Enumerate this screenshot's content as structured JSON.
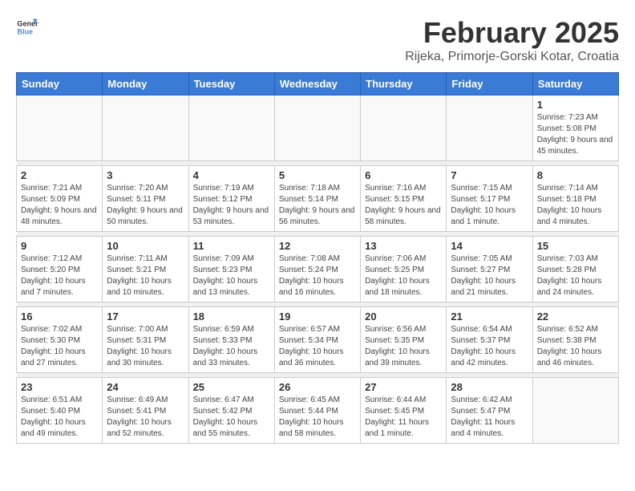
{
  "header": {
    "logo_general": "General",
    "logo_blue": "Blue",
    "title": "February 2025",
    "subtitle": "Rijeka, Primorje-Gorski Kotar, Croatia"
  },
  "weekdays": [
    "Sunday",
    "Monday",
    "Tuesday",
    "Wednesday",
    "Thursday",
    "Friday",
    "Saturday"
  ],
  "weeks": [
    [
      {
        "num": "",
        "info": ""
      },
      {
        "num": "",
        "info": ""
      },
      {
        "num": "",
        "info": ""
      },
      {
        "num": "",
        "info": ""
      },
      {
        "num": "",
        "info": ""
      },
      {
        "num": "",
        "info": ""
      },
      {
        "num": "1",
        "info": "Sunrise: 7:23 AM\nSunset: 5:08 PM\nDaylight: 9 hours and 45 minutes."
      }
    ],
    [
      {
        "num": "2",
        "info": "Sunrise: 7:21 AM\nSunset: 5:09 PM\nDaylight: 9 hours and 48 minutes."
      },
      {
        "num": "3",
        "info": "Sunrise: 7:20 AM\nSunset: 5:11 PM\nDaylight: 9 hours and 50 minutes."
      },
      {
        "num": "4",
        "info": "Sunrise: 7:19 AM\nSunset: 5:12 PM\nDaylight: 9 hours and 53 minutes."
      },
      {
        "num": "5",
        "info": "Sunrise: 7:18 AM\nSunset: 5:14 PM\nDaylight: 9 hours and 56 minutes."
      },
      {
        "num": "6",
        "info": "Sunrise: 7:16 AM\nSunset: 5:15 PM\nDaylight: 9 hours and 58 minutes."
      },
      {
        "num": "7",
        "info": "Sunrise: 7:15 AM\nSunset: 5:17 PM\nDaylight: 10 hours and 1 minute."
      },
      {
        "num": "8",
        "info": "Sunrise: 7:14 AM\nSunset: 5:18 PM\nDaylight: 10 hours and 4 minutes."
      }
    ],
    [
      {
        "num": "9",
        "info": "Sunrise: 7:12 AM\nSunset: 5:20 PM\nDaylight: 10 hours and 7 minutes."
      },
      {
        "num": "10",
        "info": "Sunrise: 7:11 AM\nSunset: 5:21 PM\nDaylight: 10 hours and 10 minutes."
      },
      {
        "num": "11",
        "info": "Sunrise: 7:09 AM\nSunset: 5:23 PM\nDaylight: 10 hours and 13 minutes."
      },
      {
        "num": "12",
        "info": "Sunrise: 7:08 AM\nSunset: 5:24 PM\nDaylight: 10 hours and 16 minutes."
      },
      {
        "num": "13",
        "info": "Sunrise: 7:06 AM\nSunset: 5:25 PM\nDaylight: 10 hours and 18 minutes."
      },
      {
        "num": "14",
        "info": "Sunrise: 7:05 AM\nSunset: 5:27 PM\nDaylight: 10 hours and 21 minutes."
      },
      {
        "num": "15",
        "info": "Sunrise: 7:03 AM\nSunset: 5:28 PM\nDaylight: 10 hours and 24 minutes."
      }
    ],
    [
      {
        "num": "16",
        "info": "Sunrise: 7:02 AM\nSunset: 5:30 PM\nDaylight: 10 hours and 27 minutes."
      },
      {
        "num": "17",
        "info": "Sunrise: 7:00 AM\nSunset: 5:31 PM\nDaylight: 10 hours and 30 minutes."
      },
      {
        "num": "18",
        "info": "Sunrise: 6:59 AM\nSunset: 5:33 PM\nDaylight: 10 hours and 33 minutes."
      },
      {
        "num": "19",
        "info": "Sunrise: 6:57 AM\nSunset: 5:34 PM\nDaylight: 10 hours and 36 minutes."
      },
      {
        "num": "20",
        "info": "Sunrise: 6:56 AM\nSunset: 5:35 PM\nDaylight: 10 hours and 39 minutes."
      },
      {
        "num": "21",
        "info": "Sunrise: 6:54 AM\nSunset: 5:37 PM\nDaylight: 10 hours and 42 minutes."
      },
      {
        "num": "22",
        "info": "Sunrise: 6:52 AM\nSunset: 5:38 PM\nDaylight: 10 hours and 46 minutes."
      }
    ],
    [
      {
        "num": "23",
        "info": "Sunrise: 6:51 AM\nSunset: 5:40 PM\nDaylight: 10 hours and 49 minutes."
      },
      {
        "num": "24",
        "info": "Sunrise: 6:49 AM\nSunset: 5:41 PM\nDaylight: 10 hours and 52 minutes."
      },
      {
        "num": "25",
        "info": "Sunrise: 6:47 AM\nSunset: 5:42 PM\nDaylight: 10 hours and 55 minutes."
      },
      {
        "num": "26",
        "info": "Sunrise: 6:45 AM\nSunset: 5:44 PM\nDaylight: 10 hours and 58 minutes."
      },
      {
        "num": "27",
        "info": "Sunrise: 6:44 AM\nSunset: 5:45 PM\nDaylight: 11 hours and 1 minute."
      },
      {
        "num": "28",
        "info": "Sunrise: 6:42 AM\nSunset: 5:47 PM\nDaylight: 11 hours and 4 minutes."
      },
      {
        "num": "",
        "info": ""
      }
    ]
  ]
}
